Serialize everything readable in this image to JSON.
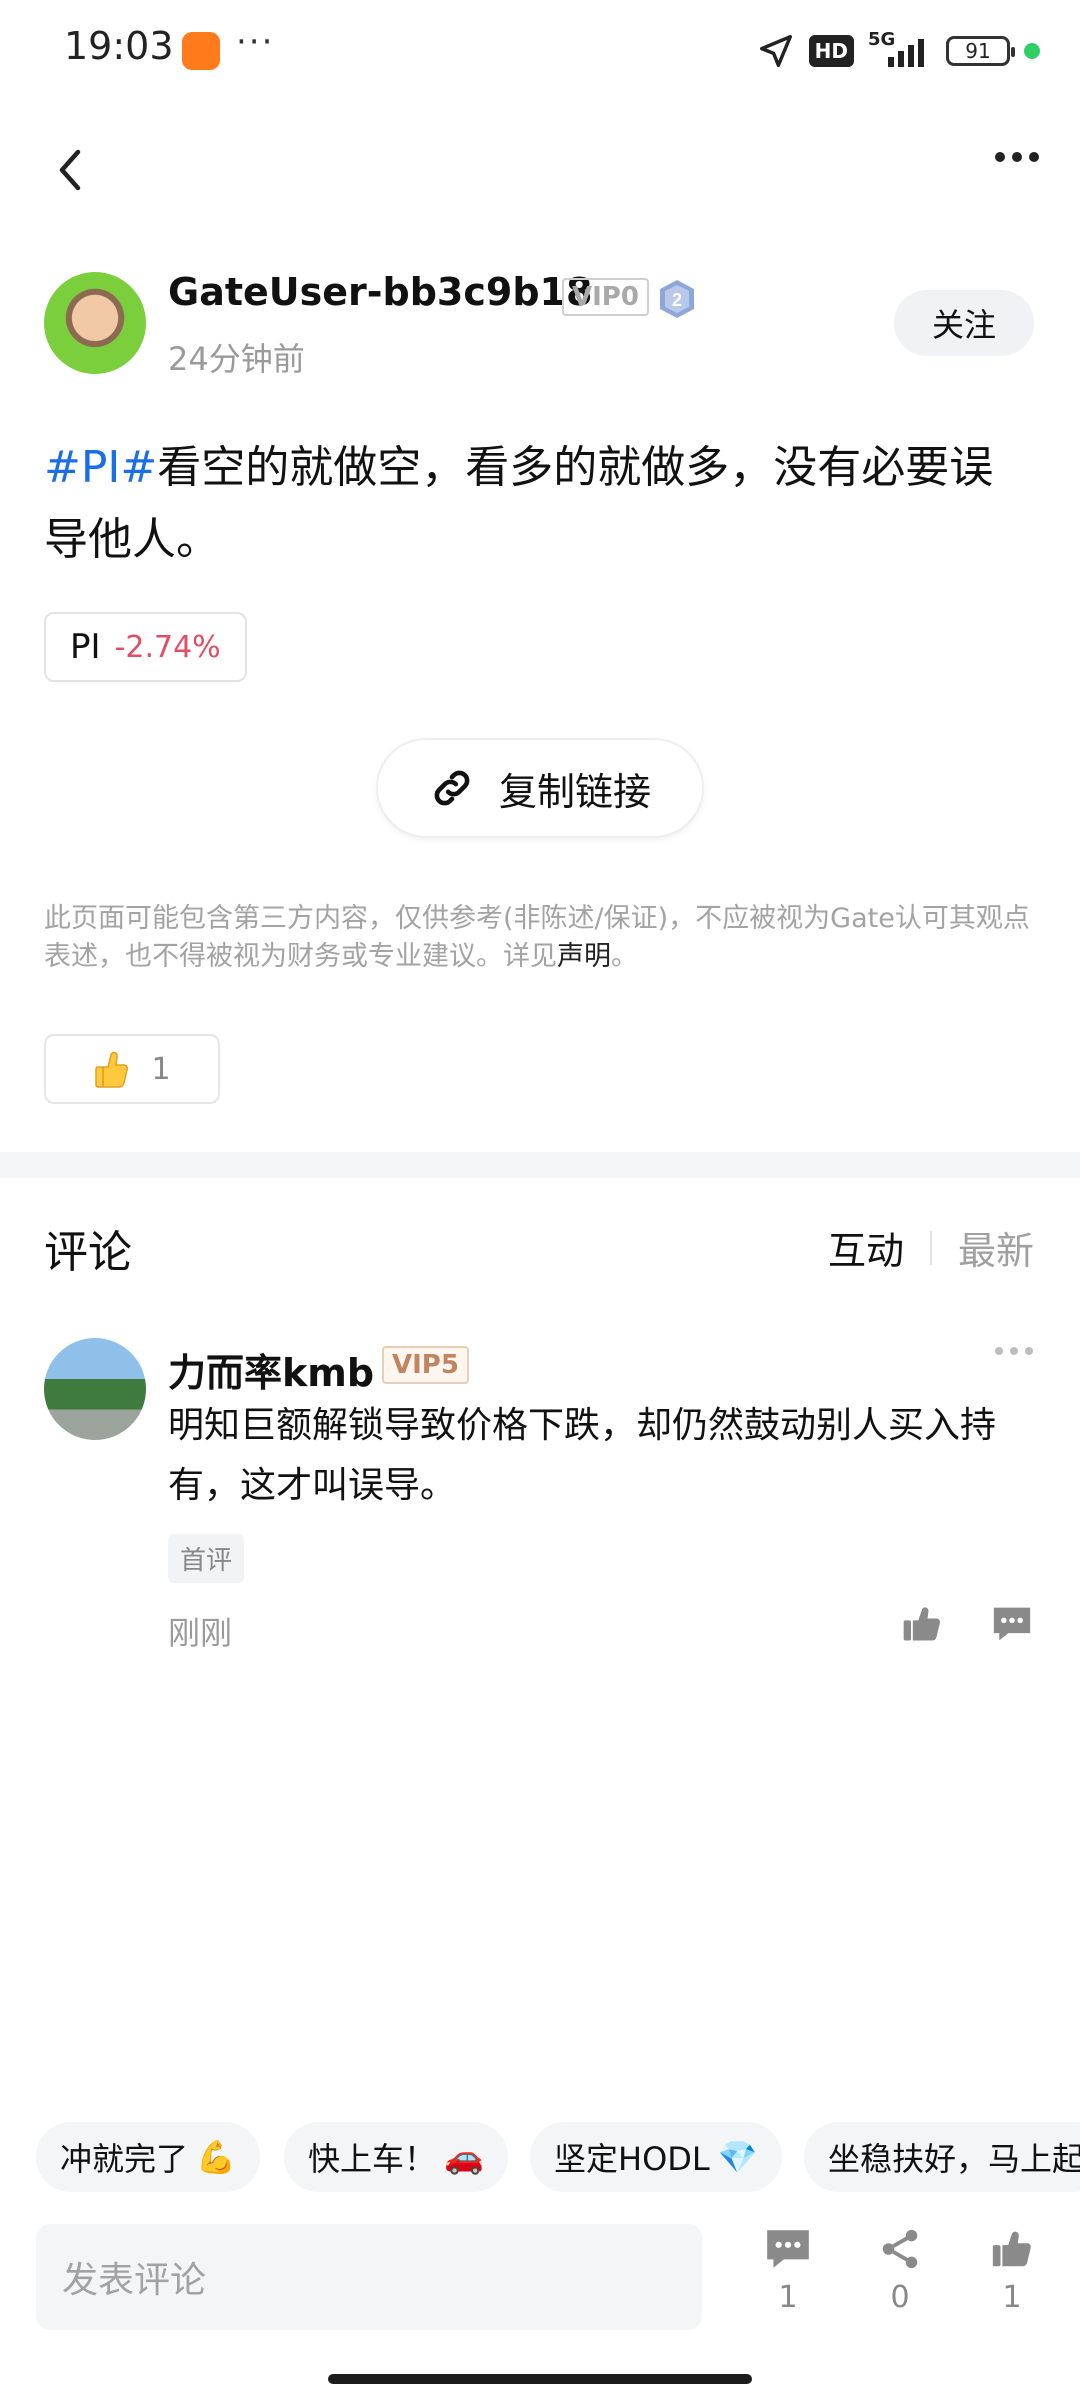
{
  "status_bar": {
    "time": "19:03",
    "more": "···",
    "hd": "HD",
    "network": "5G",
    "battery": "91"
  },
  "post": {
    "author": "GateUser-bb3c9b18",
    "vip": "VIP0",
    "level": "2",
    "time": "24分钟前",
    "follow_label": "关注",
    "hashtag": "#PI#",
    "text": "看空的就做空，看多的就做多，没有必要误导他人。",
    "ticker": {
      "symbol": "PI",
      "change": "-2.74%"
    },
    "copy_link_label": "复制链接",
    "disclaimer": "此页面可能包含第三方内容，仅供参考(非陈述/保证)，不应被视为Gate认可其观点表述，也不得被视为财务或专业建议。详见",
    "disclaimer_link": "声明",
    "disclaimer_end": "。",
    "likes": "1"
  },
  "comments": {
    "title": "评论",
    "sort_active": "互动",
    "sort_inactive": "最新",
    "items": [
      {
        "name": "力而率kmb",
        "vip": "VIP5",
        "text": "明知巨额解锁导致价格下跌，却仍然鼓动别人买入持有，这才叫误导。",
        "tag": "首评",
        "time": "刚刚"
      }
    ]
  },
  "quick_replies": [
    {
      "text": "冲就完了",
      "emoji": "💪"
    },
    {
      "text": "快上车！",
      "emoji": "🚗"
    },
    {
      "text": "坚定HODL",
      "emoji": "💎"
    },
    {
      "text": "坐稳扶好，马上起",
      "emoji": ""
    }
  ],
  "bottom_bar": {
    "input_placeholder": "发表评论",
    "comment_count": "1",
    "share_count": "0",
    "like_count": "1"
  },
  "colors": {
    "accent_blue": "#1a6fe8",
    "negative_red": "#e24d63",
    "online_green": "#2fcf65"
  }
}
